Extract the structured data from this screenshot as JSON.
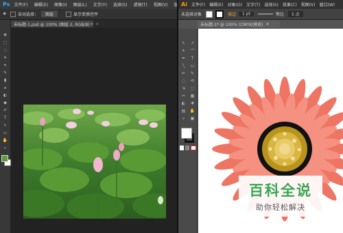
{
  "ps": {
    "logo": "Ps",
    "menu": [
      "文件(F)",
      "编辑(E)",
      "图像(I)",
      "图层(L)",
      "文字(Y)",
      "选择(S)",
      "滤镜(T)",
      "视图(V)",
      "窗口(W)"
    ],
    "options": {
      "auto_select": "自动选择：",
      "layer_select": "图层",
      "show_transform": "显示变换控件"
    },
    "tab_title": "未标题-1.psd @ 100% (图层 2, RGB/8) *",
    "tools": [
      "✥",
      "⬚",
      "◌",
      "✶",
      "⌗",
      "✎",
      "▮",
      "⌀",
      "◐",
      "◆",
      "✐",
      "T",
      "↖",
      "▭",
      "✋",
      "⌕"
    ],
    "colors": {
      "fg": "#5f9a3b",
      "bg": "#ffffff"
    }
  },
  "ai": {
    "logo": "Ai",
    "menu": [
      "文件(F)",
      "编辑(E)",
      "对象(O)",
      "文字(T)",
      "选择(S)",
      "效果(C)",
      "视图(V)",
      "窗口(W)"
    ],
    "options": {
      "no_selection": "未选择对象",
      "stroke_label": "描边",
      "stroke_value": "1 pt",
      "profile": "等比",
      "brush": "5 点"
    },
    "tab_title": "未标题-1* @ 100% (CMYK/预览)",
    "tools": [
      "↖",
      "↗",
      "✴",
      "⌒",
      "✒",
      "T",
      "╲",
      "▭",
      "✏",
      "✎",
      "◌",
      "⟲",
      "⇲",
      "⬚",
      "✂",
      "▦",
      "◐",
      "✚",
      "▤",
      "✋",
      "⌕",
      "▣"
    ]
  },
  "watermark": {
    "title": "百科全说",
    "subtitle": "助你轻松解决"
  }
}
